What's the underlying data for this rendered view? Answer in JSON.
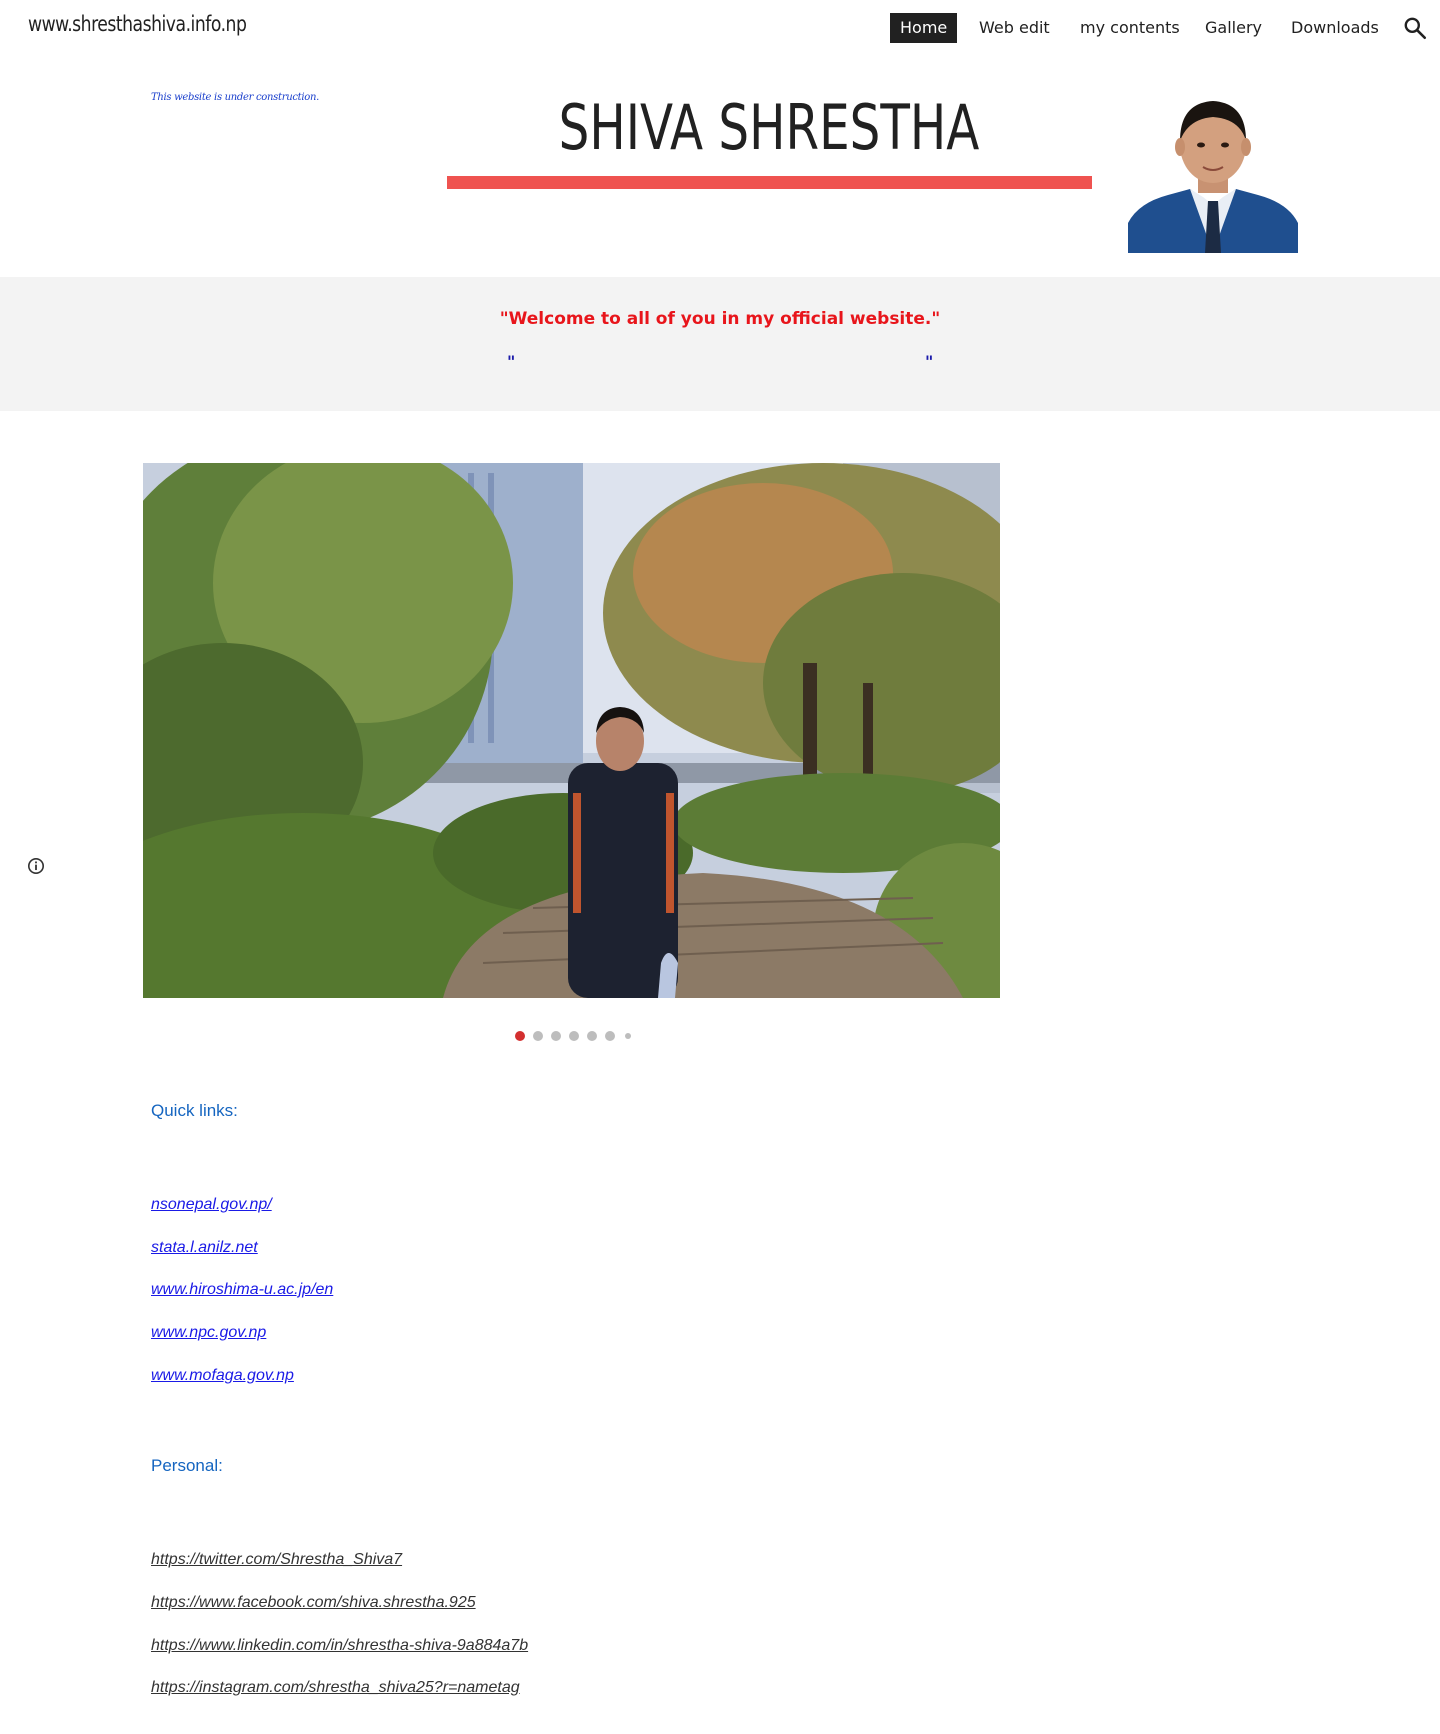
{
  "nav": {
    "site_title": "www.shresthashiva.info.np",
    "items": [
      {
        "label": "Home",
        "active": true
      },
      {
        "label": "Web edit"
      },
      {
        "label": "my contents"
      },
      {
        "label": "Gallery"
      },
      {
        "label": "Downloads"
      }
    ],
    "search_icon": "search-icon"
  },
  "header": {
    "note": "This website is under construction.",
    "name": "SHIVA SHRESTHA",
    "accent_color": "#ef5350"
  },
  "welcome": {
    "message": "\"Welcome to all of you in my official website.\"",
    "quote_open": "\"",
    "quote_close": "\""
  },
  "carousel": {
    "slide_count": 7,
    "active_index": 0
  },
  "quick_links": {
    "heading": "Quick links:",
    "links": [
      "nsonepal.gov.np/ ",
      "stata.l.anilz.net",
      "www.hiroshima-u.ac.jp/en",
      "www.npc.gov.np",
      "www.mofaga.gov.np "
    ]
  },
  "personal": {
    "heading": "Personal:",
    "links": [
      "https://twitter.com/Shrestha_Shiva7",
      "https://www.facebook.com/shiva.shrestha.925",
      "https://www.linkedin.com/in/shrestha-shiva-9a884a7b",
      "https://instagram.com/shrestha_shiva25?r=nametag"
    ]
  }
}
